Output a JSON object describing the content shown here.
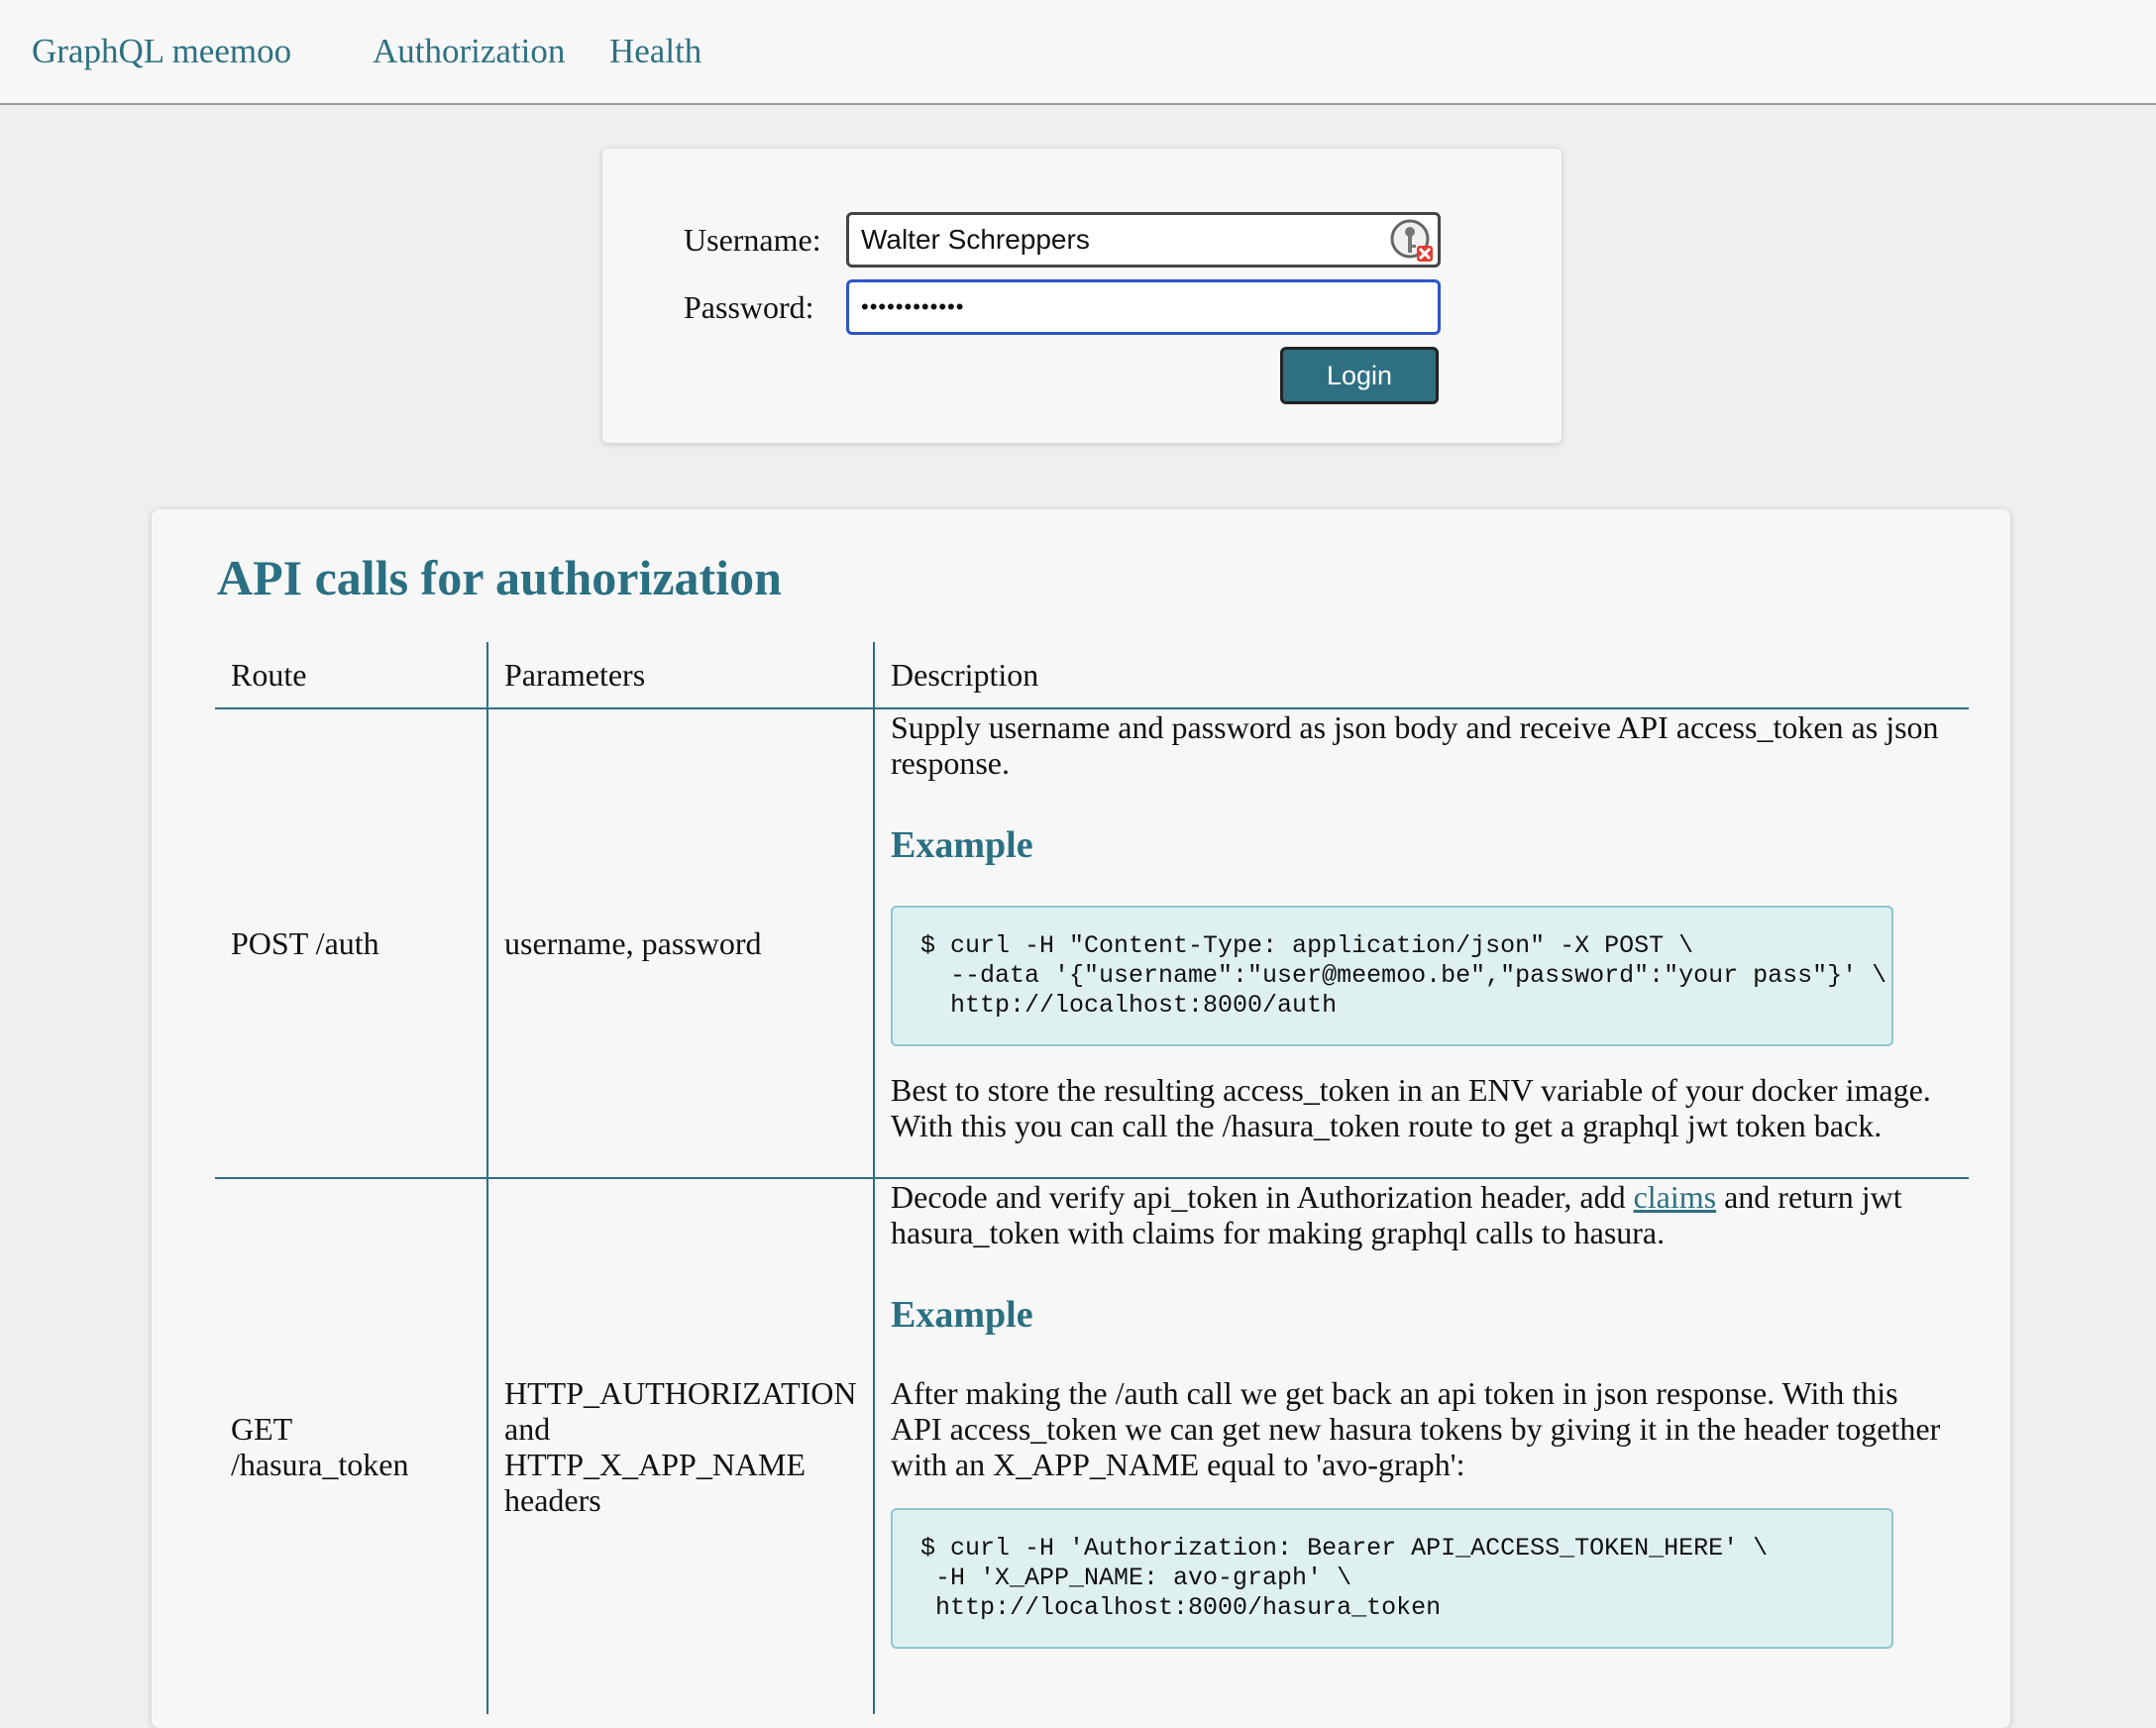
{
  "nav": {
    "brand": "GraphQL meemoo",
    "links": [
      "Authorization",
      "Health"
    ]
  },
  "login": {
    "username_label": "Username:",
    "password_label": "Password:",
    "username_value": "Walter Schreppers",
    "password_value": "••••••••••••",
    "button_label": "Login",
    "icon": "password-manager-key-icon"
  },
  "api": {
    "title": "API calls for authorization",
    "columns": [
      "Route",
      "Parameters",
      "Description"
    ],
    "rows": [
      {
        "route": "POST /auth",
        "parameters": "username, password",
        "description_intro": "Supply username and password as json body and receive API access_token as json response.",
        "example_heading": "Example",
        "code": "$ curl -H \"Content-Type: application/json\" -X POST \\\n  --data '{\"username\":\"user@meemoo.be\",\"password\":\"your pass\"}' \\\n  http://localhost:8000/auth",
        "description_after": "Best to store the resulting access_token in an ENV variable of your docker image. With this you can call the /hasura_token route to get a graphql jwt token back."
      },
      {
        "route_line1": "GET",
        "route_line2": "/hasura_token",
        "parameters_line1": "HTTP_AUTHORIZATION",
        "parameters_line2": "and",
        "parameters_line3": "HTTP_X_APP_NAME",
        "parameters_line4": "headers",
        "description_intro_before_link": "Decode and verify api_token in Authorization header, add ",
        "description_link": "claims",
        "description_intro_after_link": " and return jwt hasura_token with claims for making graphql calls to hasura.",
        "example_heading": "Example",
        "example_intro": "After making the /auth call we get back an api token in json response. With this API access_token we can get new hasura tokens by giving it in the header together with an X_APP_NAME equal to 'avo-graph':",
        "code": "$ curl -H 'Authorization: Bearer API_ACCESS_TOKEN_HERE' \\\n -H 'X_APP_NAME: avo-graph' \\\n http://localhost:8000/hasura_token"
      }
    ]
  },
  "colors": {
    "accent": "#2e7183",
    "code_bg": "#dff0f0",
    "button_bg": "#2f6f82",
    "focus_border": "#2d55c8"
  }
}
